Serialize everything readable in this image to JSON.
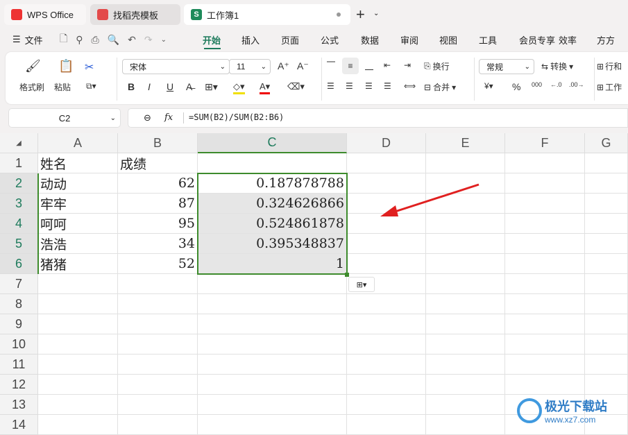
{
  "tabs": [
    {
      "label": "WPS Office",
      "icon": "W"
    },
    {
      "label": "找稻壳模板",
      "icon": "D"
    },
    {
      "label": "工作簿1",
      "icon": "S"
    }
  ],
  "menu": {
    "file": "文件",
    "items": [
      "开始",
      "插入",
      "页面",
      "公式",
      "数据",
      "审阅",
      "视图",
      "工具",
      "会员专享",
      "效率",
      "方方"
    ],
    "active": 0
  },
  "ribbon": {
    "format_painter": "格式刷",
    "paste": "粘贴",
    "font": "宋体",
    "size": "11",
    "wrap": "换行",
    "merge": "合并",
    "number_format": "常规",
    "convert": "转换",
    "rows_cols": "行和",
    "worksheet": "工作",
    "bold": "B",
    "italic": "I",
    "underline": "U",
    "percent": "%"
  },
  "formula_bar": {
    "cell_ref": "C2",
    "fx": "fx",
    "formula": "=SUM(B2)/SUM(B2:B6)"
  },
  "columns": [
    "A",
    "B",
    "C",
    "D",
    "E",
    "F",
    "G"
  ],
  "rows": [
    "1",
    "2",
    "3",
    "4",
    "5",
    "6",
    "7",
    "8",
    "9",
    "10",
    "11",
    "12",
    "13",
    "14"
  ],
  "cells": [
    [
      "姓名",
      "成绩",
      ""
    ],
    [
      "动动",
      "62",
      "0.187878788"
    ],
    [
      "牢牢",
      "87",
      "0.324626866"
    ],
    [
      "呵呵",
      "95",
      "0.524861878"
    ],
    [
      "浩浩",
      "34",
      "0.395348837"
    ],
    [
      "猪猪",
      "52",
      "1"
    ]
  ],
  "watermark": {
    "name": "极光下载站",
    "url": "www.xz7.com"
  },
  "colors": {
    "accent": "#1e7b5c",
    "selection": "#3d8b2c",
    "arrow": "#e02020"
  }
}
